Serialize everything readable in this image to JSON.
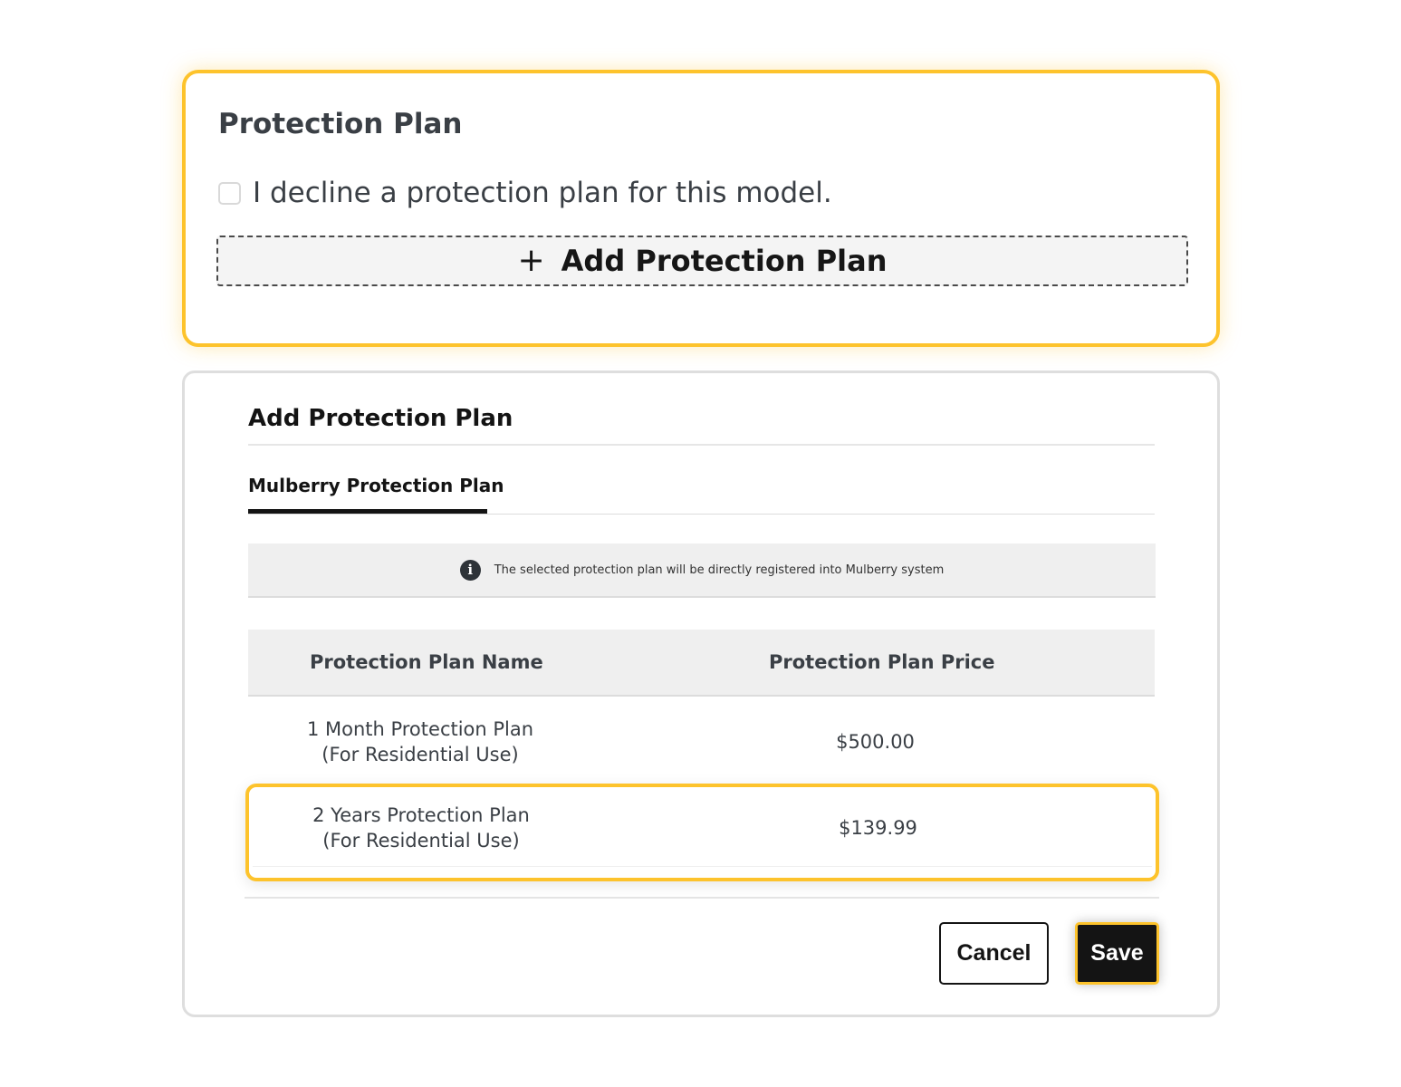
{
  "protection_section": {
    "title": "Protection Plan",
    "decline_label": "I decline a protection plan for this model.",
    "decline_checked": false,
    "add_button": {
      "icon": "plus-icon",
      "icon_glyph": "+",
      "label": "Add Protection Plan"
    }
  },
  "modal": {
    "title": "Add Protection Plan",
    "tabs": [
      {
        "label": "Mulberry Protection Plan",
        "active": true
      }
    ],
    "notice": {
      "icon": "info-icon",
      "icon_glyph": "i",
      "text": "The selected protection plan will be directly registered into Mulberry system"
    },
    "table": {
      "headers": {
        "name": "Protection Plan Name",
        "price": "Protection Plan Price"
      },
      "rows": [
        {
          "name_line1": "1 Month Protection Plan",
          "name_line2": "(For Residential Use)",
          "price": "$500.00",
          "selected": false
        },
        {
          "name_line1": "2 Years Protection Plan",
          "name_line2": "(For Residential Use)",
          "price": "$139.99",
          "selected": true
        }
      ]
    },
    "buttons": {
      "cancel": "Cancel",
      "save": "Save"
    }
  },
  "colors": {
    "highlight": "#fdc32c",
    "primary_dark": "#141414",
    "muted_bg": "#efefef"
  }
}
